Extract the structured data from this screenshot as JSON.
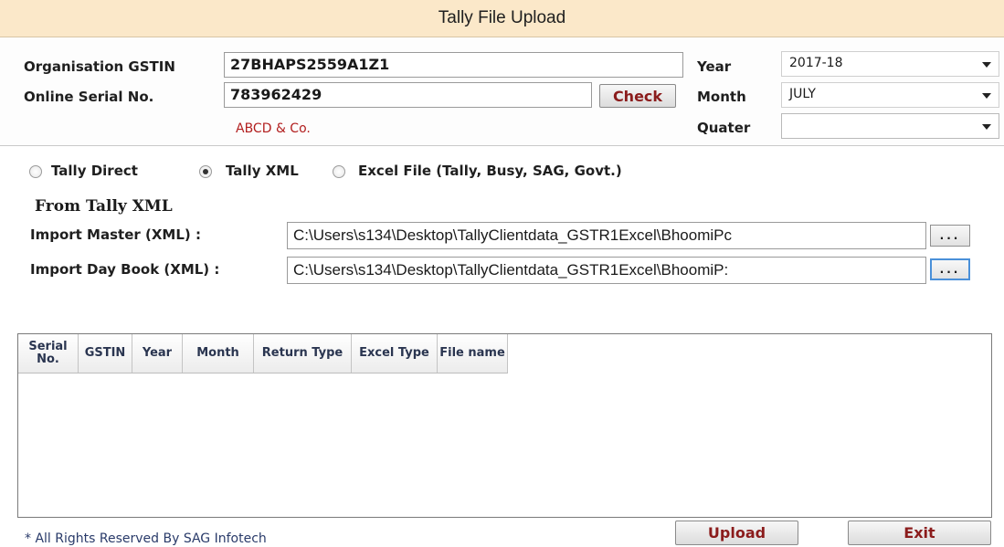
{
  "window": {
    "title": "Tally File Upload"
  },
  "top": {
    "gstin_label": "Organisation GSTIN",
    "gstin_value": "27BHAPS2559A1Z1",
    "serial_label": "Online Serial No.",
    "serial_value": "783962429",
    "check_label": "Check",
    "org_name": "ABCD & Co.",
    "year_label": "Year",
    "year_value": "2017-18",
    "month_label": "Month",
    "month_value": "JULY",
    "quarter_label": "Quater",
    "quarter_value": ""
  },
  "source": {
    "options": [
      {
        "label": "Tally Direct",
        "selected": false
      },
      {
        "label": "Tally XML",
        "selected": true
      },
      {
        "label": "Excel File (Tally, Busy, SAG, Govt.)",
        "selected": false
      }
    ]
  },
  "from_xml": {
    "heading": "From Tally XML",
    "master_label": "Import Master (XML) :",
    "master_path": "C:\\Users\\s134\\Desktop\\TallyClientdata_GSTR1Excel\\BhoomiPc",
    "daybook_label": "Import Day Book (XML) :",
    "daybook_path": "C:\\Users\\s134\\Desktop\\TallyClientdata_GSTR1Excel\\BhoomiP:",
    "browse_label": "..."
  },
  "grid": {
    "columns": [
      "Serial No.",
      "GSTIN",
      "Year",
      "Month",
      "Return Type",
      "Excel Type",
      "File name"
    ],
    "rows": []
  },
  "footer": {
    "copyright": "* All Rights Reserved By SAG Infotech",
    "upload_label": "Upload",
    "exit_label": "Exit"
  }
}
